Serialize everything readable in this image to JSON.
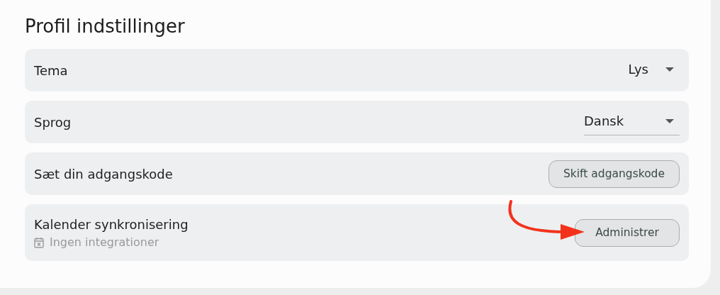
{
  "title": "Profil indstillinger",
  "settings": [
    {
      "kind": "select",
      "label": "Tema",
      "value": "Lys",
      "underlined": false
    },
    {
      "kind": "select",
      "label": "Sprog",
      "value": "Dansk",
      "underlined": true
    },
    {
      "kind": "button",
      "label": "Sæt din adgangskode",
      "button": "Skift adgangskode"
    },
    {
      "kind": "button",
      "label": "Kalender synkronisering",
      "subtitle": "Ingen integrationer",
      "button": "Administrer",
      "annotated": true
    }
  ]
}
